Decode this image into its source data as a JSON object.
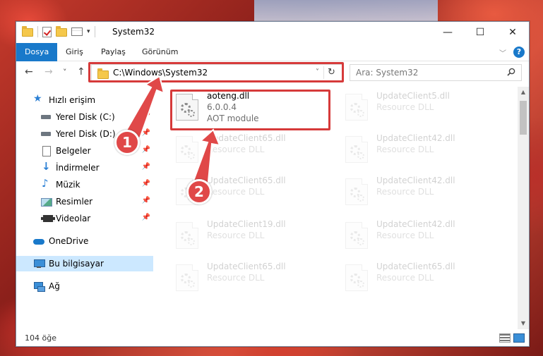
{
  "window": {
    "title": "System32",
    "controls": {
      "minimize": "—",
      "maximize": "☐",
      "close": "✕"
    }
  },
  "ribbon": {
    "tabs": [
      {
        "label": "Dosya",
        "active": true
      },
      {
        "label": "Giriş",
        "active": false
      },
      {
        "label": "Paylaş",
        "active": false
      },
      {
        "label": "Görünüm",
        "active": false
      }
    ],
    "expand": "﹀",
    "help": "?"
  },
  "navigation": {
    "back": "←",
    "forward": "→",
    "recent": "˅",
    "up": "↑",
    "address": "C:\\Windows\\System32",
    "address_dropdown": "˅",
    "refresh": "↻",
    "search_placeholder": "Ara: System32"
  },
  "sidebar": {
    "items": [
      {
        "label": "Hızlı erişim",
        "icon": "star-icon",
        "pinned": false
      },
      {
        "label": "Yerel Disk (C:)",
        "icon": "drive-icon",
        "pinned": true
      },
      {
        "label": "Yerel Disk (D:)",
        "icon": "drive-icon",
        "pinned": true
      },
      {
        "label": "Belgeler",
        "icon": "document-icon",
        "pinned": true
      },
      {
        "label": "İndirmeler",
        "icon": "download-icon",
        "pinned": true
      },
      {
        "label": "Müzik",
        "icon": "music-icon",
        "pinned": true
      },
      {
        "label": "Resimler",
        "icon": "pictures-icon",
        "pinned": true
      },
      {
        "label": "Videolar",
        "icon": "video-icon",
        "pinned": true
      },
      {
        "label": "OneDrive",
        "icon": "cloud-icon",
        "pinned": false
      },
      {
        "label": "Bu bilgisayar",
        "icon": "computer-icon",
        "pinned": false,
        "selected": true
      },
      {
        "label": "Ağ",
        "icon": "network-icon",
        "pinned": false
      }
    ],
    "pin_glyph": "📌"
  },
  "files": {
    "highlighted": {
      "name": "aoteng.dll",
      "version": "6.0.0.4",
      "description": "AOT module"
    },
    "faded": [
      {
        "name": "UpdateClient5.dll",
        "type": "Resource DLL"
      },
      {
        "name": "UpdateClient65.dll",
        "type": "Resource DLL"
      },
      {
        "name": "UpdateClient42.dll",
        "type": "Resource DLL"
      },
      {
        "name": "UpdateClient65.dll",
        "type": "Resource DLL"
      },
      {
        "name": "UpdateClient42.dll",
        "type": "Resource DLL"
      },
      {
        "name": "UpdateClient19.dll",
        "type": "Resource DLL"
      },
      {
        "name": "UpdateClient42.dll",
        "type": "Resource DLL"
      },
      {
        "name": "UpdateClient65.dll",
        "type": "Resource DLL"
      },
      {
        "name": "UpdateClient65.dll",
        "type": "Resource DLL"
      }
    ]
  },
  "status": {
    "count": "104 öğe"
  },
  "callouts": {
    "first": "1",
    "second": "2"
  },
  "colors": {
    "accent": "#1979ca",
    "highlight": "#d63a3a",
    "callout": "#e04848"
  }
}
